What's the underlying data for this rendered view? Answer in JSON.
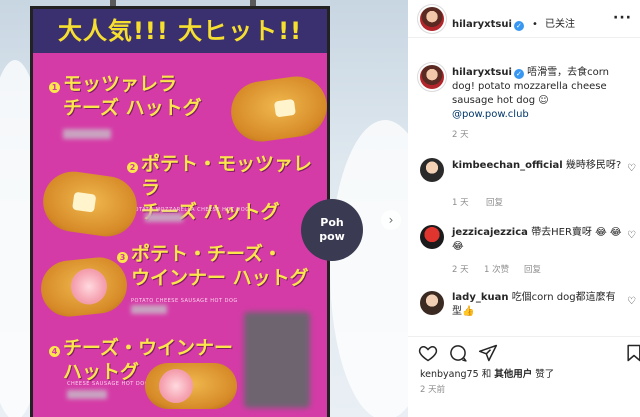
{
  "poster": {
    "banner": "大人気!!! 大ヒット!!",
    "items": [
      {
        "number": "1",
        "title": "モッツァレラ\nチーズ ハットグ"
      },
      {
        "number": "2",
        "title": "ポテト・モッツァレラ\nチーズ ハットグ",
        "subtitle": "POTATO MOZZARELLA CHEESE HOT DOG"
      },
      {
        "number": "3",
        "title": "ポテト・チーズ・\nウインナー ハットグ",
        "subtitle": "POTATO CHEESE SAUSAGE HOT DOG"
      },
      {
        "number": "4",
        "title": "チーズ・ウインナー\nハットグ",
        "subtitle": "CHEESE SAUSAGE HOT DOG"
      }
    ],
    "logo_text": "Poh\npow"
  },
  "post": {
    "author": "hilaryxtsui",
    "follow_status": "已关注",
    "caption_prefix": "唔滑雪，去食corn dog! potato mozzarella cheese sausage hot dog ☺",
    "mention": "@pow.pow.club",
    "caption_age": "2 天"
  },
  "comments": [
    {
      "user": "kimbeechan_official",
      "text": "幾時移民呀?",
      "age": "1 天",
      "reply": "回复",
      "likes": ""
    },
    {
      "user": "jezzicajezzica",
      "text": "帶去HER賣呀 😂 😂😂",
      "age": "2 天",
      "likes": "1 次赞",
      "reply": "回复"
    },
    {
      "user": "lady_kuan",
      "text": "吃個corn dog都這麼有型👍",
      "age": "",
      "likes": "",
      "reply": ""
    }
  ],
  "footer": {
    "likes_user": "kenbyang75",
    "likes_and": "和",
    "likes_others": "其他用户",
    "likes_suffix": "赞了",
    "date": "2 天前"
  },
  "colors": {
    "poster_pink": "#d53ba7",
    "poster_yellow": "#fbe74b",
    "banner_navy": "#3a3070",
    "link": "#00376b",
    "verified": "#3897f0"
  }
}
